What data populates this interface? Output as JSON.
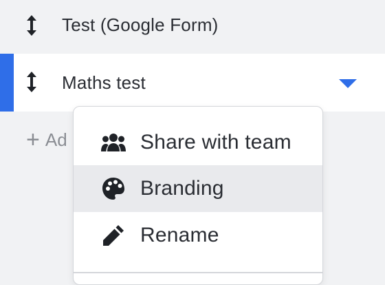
{
  "colors": {
    "accent": "#2f6ee8",
    "page_bg": "#f1f2f4",
    "menu_highlight": "#e9eaed",
    "text": "#2a2d33",
    "muted_text": "#8a8d93"
  },
  "rows": [
    {
      "label": "Test (Google Form)",
      "icon": "drag-handle-icon",
      "selected": false
    },
    {
      "label": "Maths test",
      "icon": "drag-handle-icon",
      "selected": true
    }
  ],
  "add": {
    "plus": "+",
    "label": "Ad"
  },
  "menu": {
    "items": [
      {
        "label": "Share with team",
        "icon": "team-icon"
      },
      {
        "label": "Branding",
        "icon": "palette-icon",
        "highlighted": true
      },
      {
        "label": "Rename",
        "icon": "pencil-icon"
      }
    ]
  }
}
